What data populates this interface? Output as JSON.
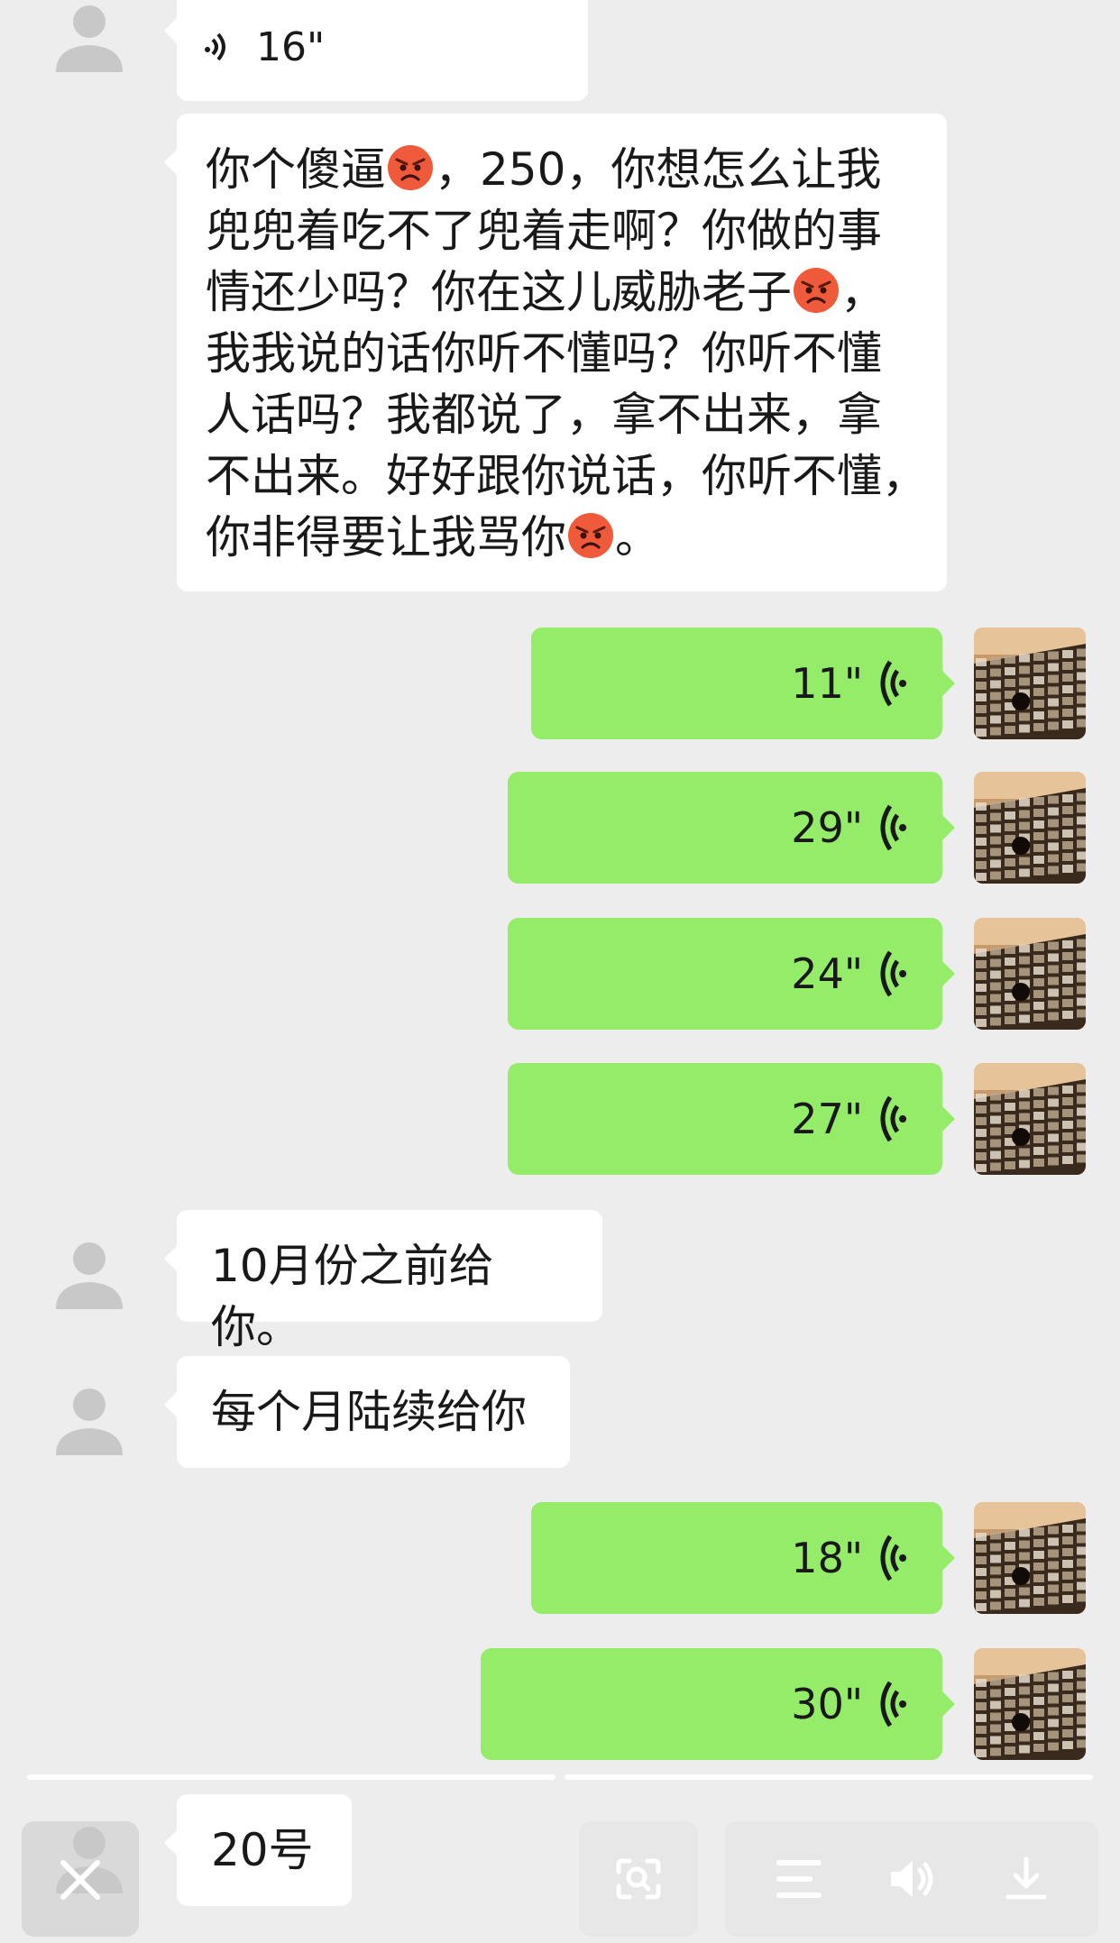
{
  "messages": {
    "incoming_voice_top": {
      "duration": "16\""
    },
    "long_text": {
      "lines": [
        [
          "你个傻逼",
          "😡",
          "，250，你想怎么让我"
        ],
        [
          "兜兜着吃不了兜着走啊？你做的事"
        ],
        [
          "情还少吗？你在这儿威胁老子",
          "😡",
          "，"
        ],
        [
          "我我说的话你听不懂吗？你听不懂"
        ],
        [
          "人话吗？我都说了，拿不出来，拿"
        ],
        [
          "不出来。好好跟你说话，你听不懂，"
        ],
        [
          "你非得要让我骂你",
          "😡",
          "。"
        ]
      ]
    },
    "outgoing_voice": [
      {
        "duration": "11\""
      },
      {
        "duration": "29\""
      },
      {
        "duration": "24\""
      },
      {
        "duration": "27\""
      }
    ],
    "text_1": "10月份之前给你。",
    "text_2": "每个月陆续给你",
    "outgoing_voice_2": [
      {
        "duration": "18\""
      },
      {
        "duration": "30\""
      }
    ],
    "text_3": "20号"
  },
  "colors": {
    "background": "#ededed",
    "incoming_bubble": "#ffffff",
    "outgoing_bubble": "#95ec69",
    "text": "#191919"
  },
  "toolbar": {
    "icons": [
      "close-icon",
      "search-image-icon",
      "menu-icon",
      "speaker-icon",
      "download-icon"
    ]
  }
}
